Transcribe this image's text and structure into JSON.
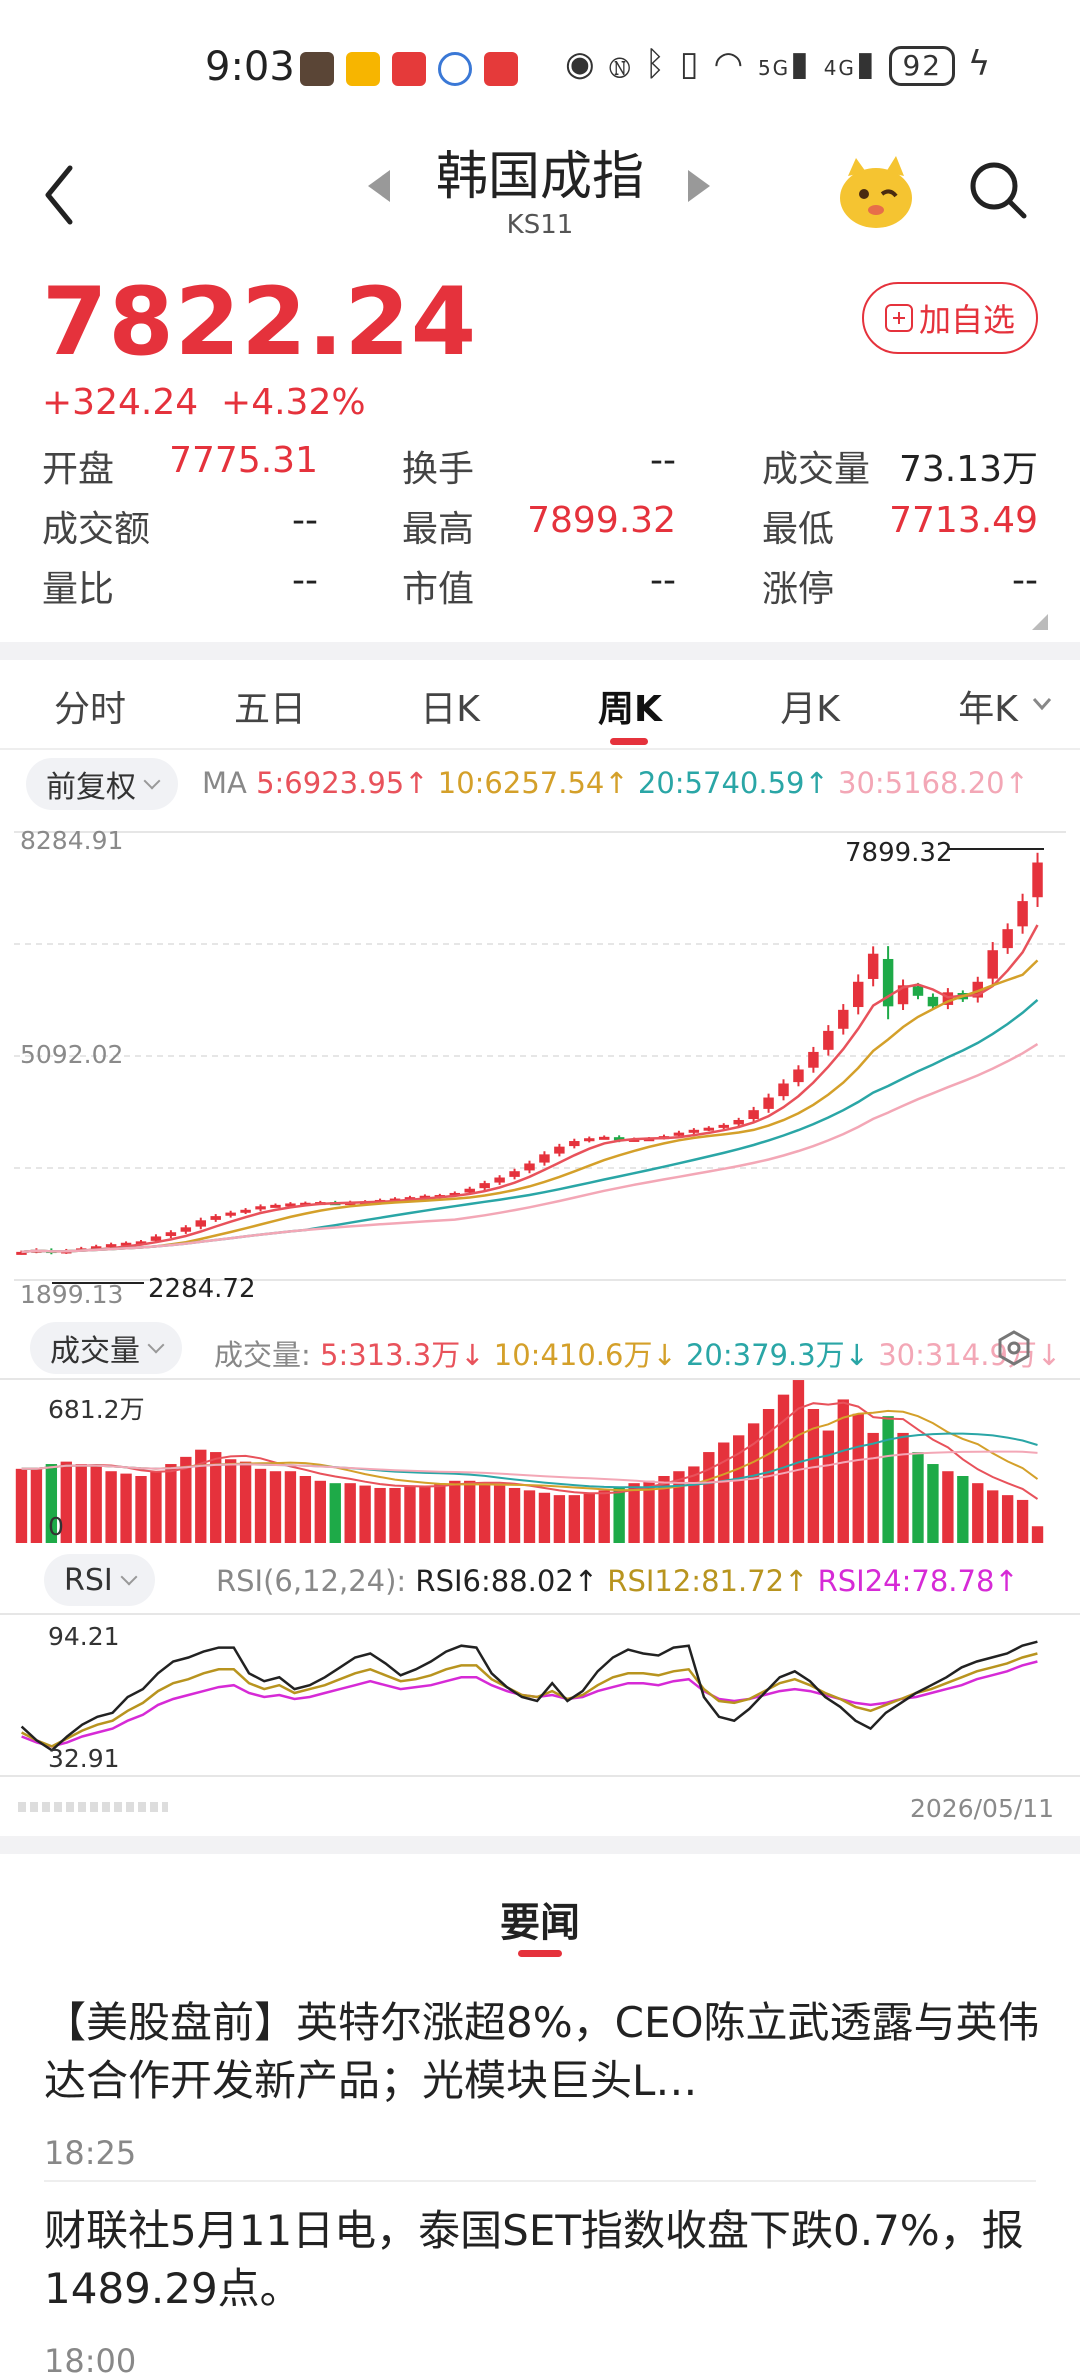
{
  "status_bar": {
    "time": "9:03",
    "network_5g": "5G",
    "network_4g": "4G",
    "battery": "92"
  },
  "header": {
    "title": "韩国成指",
    "code": "KS11",
    "add_watch": "加自选"
  },
  "quote": {
    "price": "7822.24",
    "change": "+324.24",
    "change_pct": "+4.32%"
  },
  "stats": [
    {
      "label": "开盘",
      "value": "7775.31",
      "color": "red"
    },
    {
      "label": "换手",
      "value": "--",
      "color": "dark"
    },
    {
      "label": "成交量",
      "value": "73.13万",
      "color": "dark"
    },
    {
      "label": "成交额",
      "value": "--",
      "color": "dark"
    },
    {
      "label": "最高",
      "value": "7899.32",
      "color": "red"
    },
    {
      "label": "最低",
      "value": "7713.49",
      "color": "red"
    },
    {
      "label": "量比",
      "value": "--",
      "color": "dark"
    },
    {
      "label": "市值",
      "value": "--",
      "color": "dark"
    },
    {
      "label": "涨停",
      "value": "--",
      "color": "dark"
    }
  ],
  "tabs": [
    "分时",
    "五日",
    "日K",
    "周K",
    "月K",
    "年K"
  ],
  "active_tab": "周K",
  "price_chart": {
    "adjust_label": "前复权",
    "ma_prefix": "MA",
    "ma": [
      {
        "label": "5:6923.95↑",
        "color": "#e8525b"
      },
      {
        "label": "10:6257.54↑",
        "color": "#d4a02a"
      },
      {
        "label": "20:5740.59↑",
        "color": "#2aa6a6"
      },
      {
        "label": "30:5168.20↑",
        "color": "#f3a7b6"
      }
    ],
    "y_top": "8284.91",
    "y_mid": "5092.02",
    "y_bottom": "1899.13",
    "max_label": "7899.32",
    "min_label": "2284.72"
  },
  "volume_chart": {
    "selector_label": "成交量",
    "prefix": "成交量:",
    "ma": [
      {
        "label": "5:313.3万↓",
        "color": "#e8525b"
      },
      {
        "label": "10:410.6万↓",
        "color": "#d4a02a"
      },
      {
        "label": "20:379.3万↓",
        "color": "#2aa6a6"
      },
      {
        "label": "30:314.9万↓",
        "color": "#f3a7b6"
      }
    ],
    "y_top": "681.2万",
    "y_zero": "0"
  },
  "rsi_chart": {
    "selector_label": "RSI",
    "prefix": "RSI(6,12,24):",
    "values": [
      {
        "label": "RSI6:88.02↑",
        "color": "#222222"
      },
      {
        "label": "RSI12:81.72↑",
        "color": "#b8941f"
      },
      {
        "label": "RSI24:78.78↑",
        "color": "#d62ad6"
      }
    ],
    "y_top": "94.21",
    "y_bottom": "32.91",
    "date": "2026/05/11"
  },
  "chart_data": {
    "type": "candlestick",
    "ylim": [
      1899.13,
      8284.91
    ],
    "closes": [
      2300,
      2330,
      2290,
      2320,
      2350,
      2380,
      2410,
      2430,
      2450,
      2520,
      2580,
      2650,
      2750,
      2810,
      2860,
      2900,
      2950,
      2970,
      2990,
      3000,
      3010,
      2990,
      3010,
      3020,
      3040,
      3060,
      3080,
      3100,
      3110,
      3140,
      3200,
      3280,
      3360,
      3450,
      3560,
      3690,
      3800,
      3880,
      3920,
      3940,
      3890,
      3910,
      3920,
      3950,
      4000,
      4040,
      4070,
      4110,
      4180,
      4320,
      4500,
      4700,
      4900,
      5150,
      5450,
      5750,
      6150,
      6550,
      5800,
      6100,
      5950,
      5800,
      6000,
      5900,
      6150,
      6600,
      6900,
      7300,
      7850
    ],
    "volume_ylim": [
      0,
      681.2
    ],
    "volumes": [
      310,
      310,
      330,
      340,
      330,
      320,
      300,
      290,
      280,
      300,
      330,
      360,
      390,
      380,
      350,
      340,
      310,
      300,
      300,
      280,
      260,
      250,
      250,
      240,
      230,
      230,
      240,
      240,
      250,
      260,
      260,
      250,
      240,
      230,
      220,
      210,
      200,
      200,
      210,
      220,
      230,
      250,
      260,
      280,
      300,
      320,
      380,
      420,
      450,
      500,
      560,
      620,
      681,
      560,
      470,
      600,
      540,
      460,
      530,
      460,
      380,
      330,
      300,
      280,
      250,
      220,
      200,
      180,
      70
    ],
    "rsi_ylim": [
      20,
      100
    ],
    "rsi6": [
      45,
      38,
      33,
      40,
      46,
      50,
      52,
      60,
      64,
      72,
      78,
      80,
      83,
      85,
      85,
      72,
      68,
      70,
      64,
      66,
      70,
      75,
      80,
      82,
      77,
      71,
      74,
      78,
      83,
      86,
      85,
      72,
      65,
      60,
      58,
      67,
      58,
      63,
      73,
      80,
      84,
      82,
      81,
      85,
      86,
      60,
      50,
      48,
      54,
      62,
      70,
      73,
      68,
      60,
      55,
      48,
      44,
      52,
      57,
      62,
      66,
      70,
      75,
      78,
      80,
      82,
      86,
      88
    ],
    "rsi12": [
      42,
      38,
      35,
      39,
      43,
      46,
      48,
      53,
      57,
      63,
      67,
      69,
      72,
      74,
      74,
      67,
      64,
      66,
      62,
      64,
      66,
      69,
      72,
      74,
      71,
      68,
      69,
      71,
      74,
      76,
      76,
      69,
      65,
      61,
      60,
      63,
      59,
      61,
      66,
      70,
      72,
      72,
      71,
      73,
      74,
      64,
      58,
      57,
      59,
      63,
      67,
      69,
      66,
      62,
      59,
      55,
      53,
      56,
      59,
      62,
      64,
      67,
      70,
      73,
      75,
      77,
      80,
      82
    ],
    "rsi24": [
      40,
      37,
      35,
      37,
      40,
      42,
      44,
      48,
      51,
      56,
      59,
      61,
      63,
      65,
      66,
      62,
      60,
      61,
      59,
      60,
      62,
      64,
      66,
      68,
      66,
      64,
      65,
      66,
      68,
      70,
      70,
      66,
      63,
      61,
      60,
      61,
      59,
      60,
      63,
      65,
      67,
      67,
      66,
      68,
      69,
      63,
      59,
      58,
      59,
      61,
      63,
      64,
      63,
      61,
      59,
      57,
      56,
      57,
      59,
      60,
      62,
      64,
      66,
      69,
      71,
      73,
      76,
      78
    ]
  },
  "news": {
    "section_title": "要闻",
    "items": [
      {
        "title": "【美股盘前】英特尔涨超8%，CEO陈立武透露与英伟达合作开发新产品；光模块巨头L…",
        "time": "18:25"
      },
      {
        "title": "财联社5月11日电，泰国SET指数收盘下跌0.7%，报1489.29点。",
        "time": "18:00"
      }
    ]
  }
}
